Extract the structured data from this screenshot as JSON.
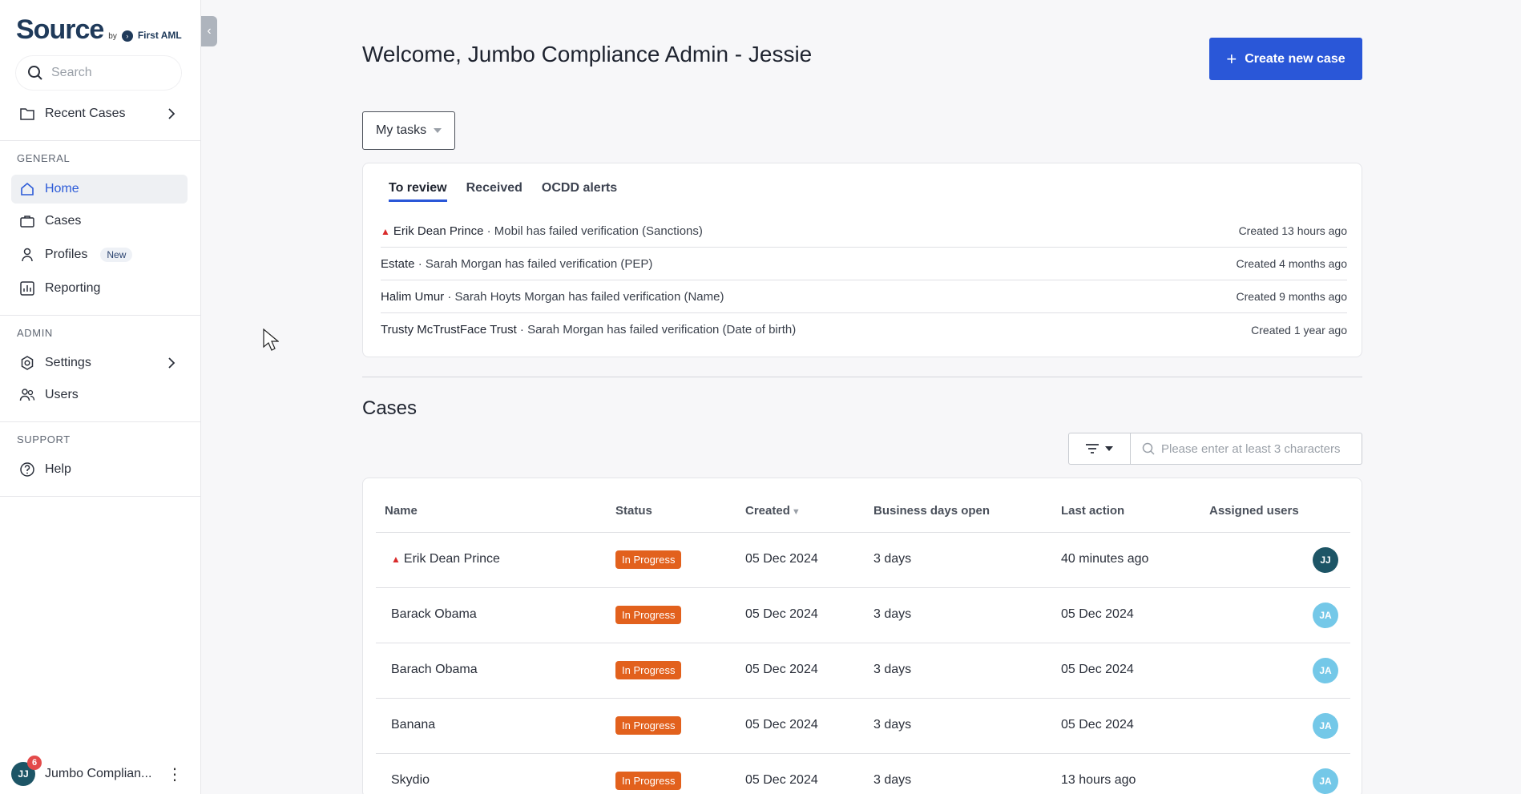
{
  "sidebar": {
    "brand": "Source",
    "brand_by": "by",
    "brand_company": "First AML",
    "search_placeholder": "Search",
    "recent_cases": "Recent Cases",
    "section_general": "GENERAL",
    "home": "Home",
    "cases": "Cases",
    "profiles": "Profiles",
    "profiles_badge": "New",
    "reporting": "Reporting",
    "section_admin": "ADMIN",
    "settings": "Settings",
    "users": "Users",
    "section_support": "SUPPORT",
    "help": "Help",
    "user_initials": "JJ",
    "user_notifications": "6",
    "user_name": "Jumbo Complian..."
  },
  "header": {
    "title": "Welcome, Jumbo Compliance Admin - Jessie",
    "create_button": "Create new case"
  },
  "tasks_dropdown": "My tasks",
  "review": {
    "tabs": [
      "To review",
      "Received",
      "OCDD alerts"
    ],
    "rows": [
      {
        "name": "Erik Dean Prince",
        "detail": " · Mobil has failed verification (Sanctions)",
        "time": "Created 13 hours ago"
      },
      {
        "name": "Estate",
        "detail": " · Sarah Morgan has failed verification (PEP)",
        "time": "Created 4 months ago"
      },
      {
        "name": "Halim Umur",
        "detail": " · Sarah Hoyts Morgan has failed verification (Name)",
        "time": "Created 9 months ago"
      },
      {
        "name": "Trusty McTrustFace Trust",
        "detail": " · Sarah Morgan has failed verification (Date of birth)",
        "time": "Created 1 year ago"
      }
    ]
  },
  "cases": {
    "title": "Cases",
    "search_placeholder": "Please enter at least 3 characters",
    "columns": {
      "name": "Name",
      "status": "Status",
      "created": "Created",
      "business_days": "Business days open",
      "last_action": "Last action",
      "assigned": "Assigned users"
    },
    "rows": [
      {
        "name": "Erik Dean Prince",
        "status": "In Progress",
        "created": "05 Dec 2024",
        "days": "3 days",
        "last_action": "40 minutes ago",
        "assigned": "JJ"
      },
      {
        "name": "Barack Obama",
        "status": "In Progress",
        "created": "05 Dec 2024",
        "days": "3 days",
        "last_action": "05 Dec 2024",
        "assigned": "JA"
      },
      {
        "name": "Barach Obama",
        "status": "In Progress",
        "created": "05 Dec 2024",
        "days": "3 days",
        "last_action": "05 Dec 2024",
        "assigned": "JA"
      },
      {
        "name": "Banana",
        "status": "In Progress",
        "created": "05 Dec 2024",
        "days": "3 days",
        "last_action": "05 Dec 2024",
        "assigned": "JA"
      },
      {
        "name": "Skydio",
        "status": "In Progress",
        "created": "05 Dec 2024",
        "days": "3 days",
        "last_action": "13 hours ago",
        "assigned": "JA"
      }
    ]
  },
  "colors": {
    "accent": "#2a57d8",
    "status_in_progress": "#e2611d",
    "avatar_dark": "#1d5566",
    "avatar_light": "#74c8e8"
  }
}
